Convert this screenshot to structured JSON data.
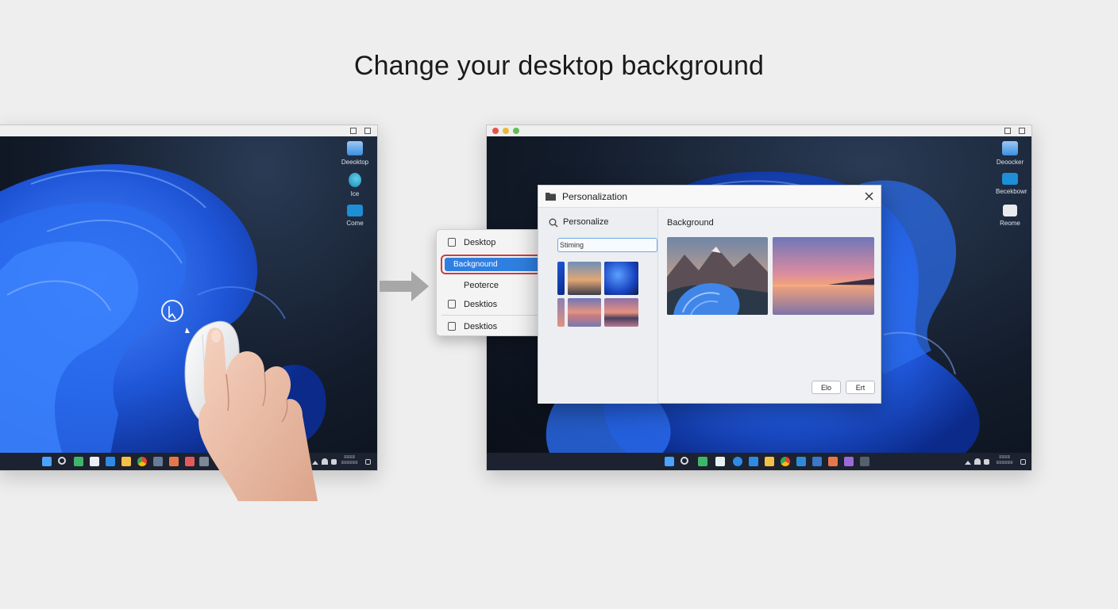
{
  "title": "Change your desktop background",
  "left_window": {
    "desktop_icons": [
      {
        "label": "Deeoktop",
        "icon": "folder-icon",
        "color": "#3b8fe0"
      },
      {
        "label": "Ice",
        "icon": "app-icon",
        "color": "#2aa6d6"
      },
      {
        "label": "Come",
        "icon": "window-icon",
        "color": "#1d8fd6"
      }
    ],
    "tray": {
      "line1": "≡≡≡≡",
      "line2": "≡≡≡≡≡≡"
    }
  },
  "context_menu": {
    "items": [
      {
        "label": "Desktop",
        "icon": "lock-icon"
      },
      {
        "label": "Backgnound",
        "selected": true
      },
      {
        "label": "Peoterce"
      },
      {
        "label": "Desktios",
        "icon": "window-icon"
      },
      {
        "label": "Desktios",
        "icon": "window-icon"
      }
    ]
  },
  "right_window": {
    "desktop_icons": [
      {
        "label": "Deoocker",
        "icon": "folder-icon",
        "color": "#3b8fe0"
      },
      {
        "label": "Becekbowr",
        "icon": "app-icon",
        "color": "#1d8fd6"
      },
      {
        "label": "Reome",
        "icon": "disk-icon",
        "color": "#e8eaee"
      }
    ]
  },
  "personalization": {
    "title": "Personalization",
    "search_label": "Personalize",
    "field_value": "Stiming",
    "section_title": "Background",
    "buttons": {
      "ok": "Elo",
      "cancel": "Ert"
    }
  },
  "colors": {
    "accent": "#2f7fe0",
    "highlight_ring": "#d23a44",
    "desktop_bloom": "#1f56d8"
  }
}
